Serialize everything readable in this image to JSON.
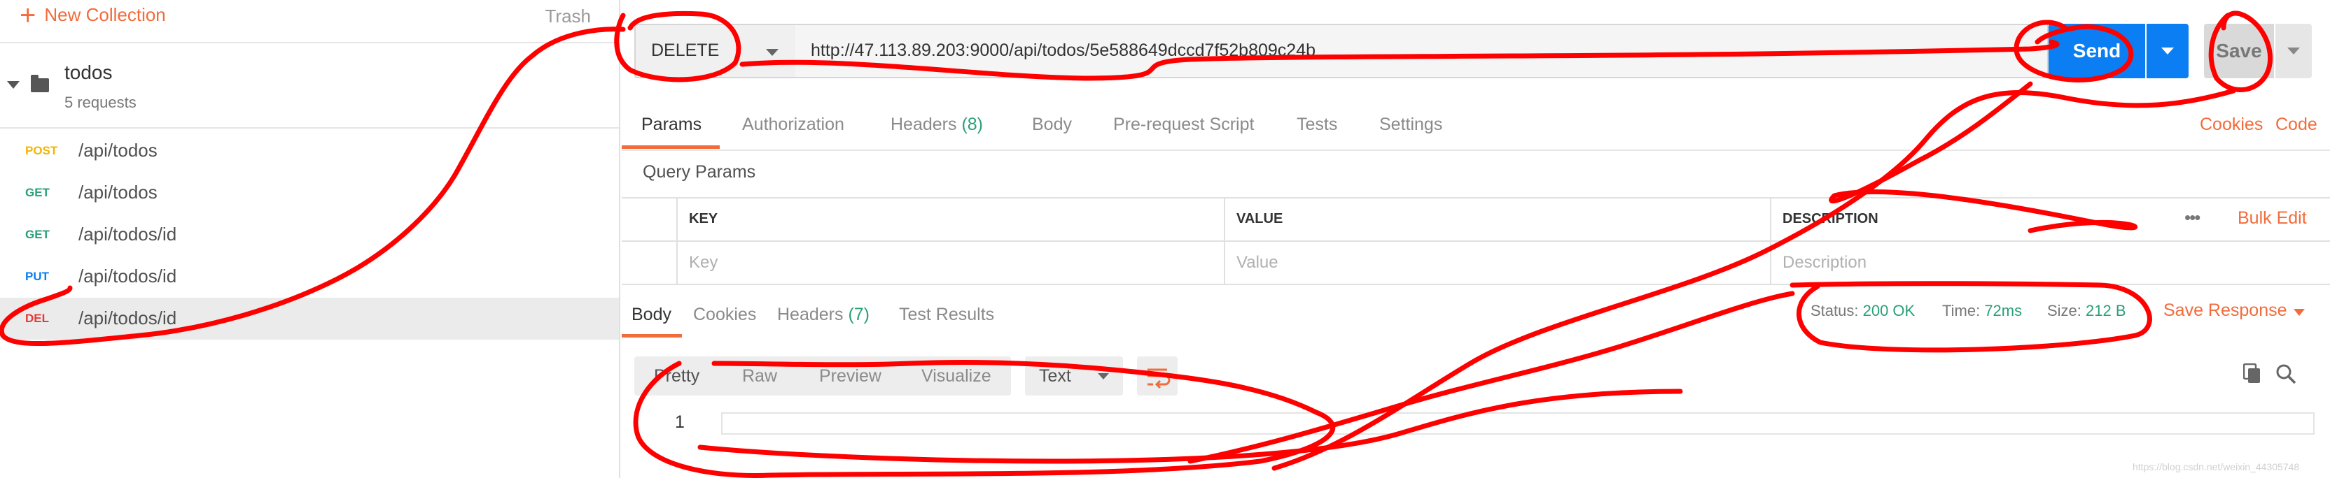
{
  "sidebar": {
    "new_collection": "New Collection",
    "trash": "Trash",
    "folder": {
      "name": "todos",
      "count": "5 requests"
    },
    "requests": [
      {
        "method": "POST",
        "path": "/api/todos",
        "color": "#f4b400"
      },
      {
        "method": "GET",
        "path": "/api/todos",
        "color": "#2aa07a"
      },
      {
        "method": "GET",
        "path": "/api/todos/id",
        "color": "#2aa07a"
      },
      {
        "method": "PUT",
        "path": "/api/todos/id",
        "color": "#0a7ef2"
      },
      {
        "method": "DEL",
        "path": "/api/todos/id",
        "color": "#e53935"
      }
    ]
  },
  "request": {
    "method": "DELETE",
    "url": "http://47.113.89.203:9000/api/todos/5e588649dccd7f52b809c24b",
    "send": "Send",
    "save": "Save"
  },
  "tabs": {
    "params": "Params",
    "authorization": "Authorization",
    "headers": "Headers",
    "headers_count": "(8)",
    "body": "Body",
    "prerequest": "Pre-request Script",
    "tests": "Tests",
    "settings": "Settings",
    "cookies": "Cookies",
    "code": "Code"
  },
  "query_params": {
    "title": "Query Params",
    "columns": {
      "key": "KEY",
      "value": "VALUE",
      "description": "DESCRIPTION"
    },
    "placeholders": {
      "key": "Key",
      "value": "Value",
      "description": "Description"
    },
    "more": "•••",
    "bulk_edit": "Bulk Edit"
  },
  "response": {
    "tabs": {
      "body": "Body",
      "cookies": "Cookies",
      "headers": "Headers",
      "headers_count": "(7)",
      "tests": "Test Results"
    },
    "status_label": "Status:",
    "status_value": "200 OK",
    "time_label": "Time:",
    "time_value": "72ms",
    "size_label": "Size:",
    "size_value": "212 B",
    "save_response": "Save Response",
    "formats": {
      "pretty": "Pretty",
      "raw": "Raw",
      "preview": "Preview",
      "visualize": "Visualize"
    },
    "text_type": "Text",
    "line_number": "1"
  },
  "colors": {
    "accent": "#f26b3a",
    "primary": "#0a7ef2",
    "annotation": "#ff0000"
  },
  "watermark": "https://blog.csdn.net/weixin_44305748"
}
